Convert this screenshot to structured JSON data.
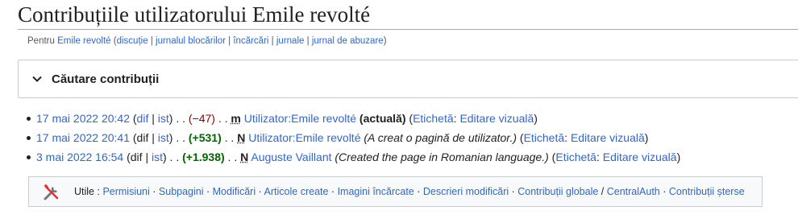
{
  "page": {
    "title": "Contribuțiile utilizatorului Emile revolté"
  },
  "subtitle": {
    "prefix": "Pentru",
    "user": "Emile revolté",
    "open": "(",
    "links": [
      "discuție",
      "jurnalul blocărilor",
      "încărcări",
      "jurnale",
      "jurnal de abuzare"
    ],
    "separator": "|",
    "close": ")"
  },
  "search": {
    "title": "Căutare contribuții",
    "icon": "chevron-down-icon"
  },
  "contributions": [
    {
      "date": "17 mai 2022 20:42",
      "dif": "dif",
      "dif_link": true,
      "ist": "ist",
      "size": "(−47)",
      "size_sign": "negative",
      "flag": "m",
      "page": "Utilizator:Emile revolté",
      "current": "(actuală)",
      "comment": "",
      "tag_label": "Etichetă",
      "tag_value": "Editare vizuală"
    },
    {
      "date": "17 mai 2022 20:41",
      "dif": "dif",
      "dif_link": false,
      "ist": "ist",
      "size": "(+531)",
      "size_sign": "positive",
      "flag": "N",
      "page": "Utilizator:Emile revolté",
      "current": "",
      "comment": "(A creat o pagină de utilizator.)",
      "tag_label": "Etichetă",
      "tag_value": "Editare vizuală"
    },
    {
      "date": "3 mai 2022 16:54",
      "dif": "dif",
      "dif_link": false,
      "ist": "ist",
      "size": "(+1.938)",
      "size_sign": "positive",
      "flag": "N",
      "page": "Auguste Vaillant",
      "current": "",
      "comment": "(Created the page in Romanian language.)",
      "tag_label": "Etichetă",
      "tag_value": "Editare vizuală"
    }
  ],
  "tools": {
    "icon": "tools-icon",
    "label": "Utile :",
    "links": [
      "Permisiuni",
      "Subpagini",
      "Modificări",
      "Articole create",
      "Imagini încărcate",
      "Descrieri modificări",
      "Contribuții globale",
      "CentralAuth",
      "Contribuții șterse"
    ]
  },
  "colors": {
    "link": "#3366cc",
    "negative": "#d33",
    "positive": "#00af89",
    "border": "#c8ccd1"
  }
}
